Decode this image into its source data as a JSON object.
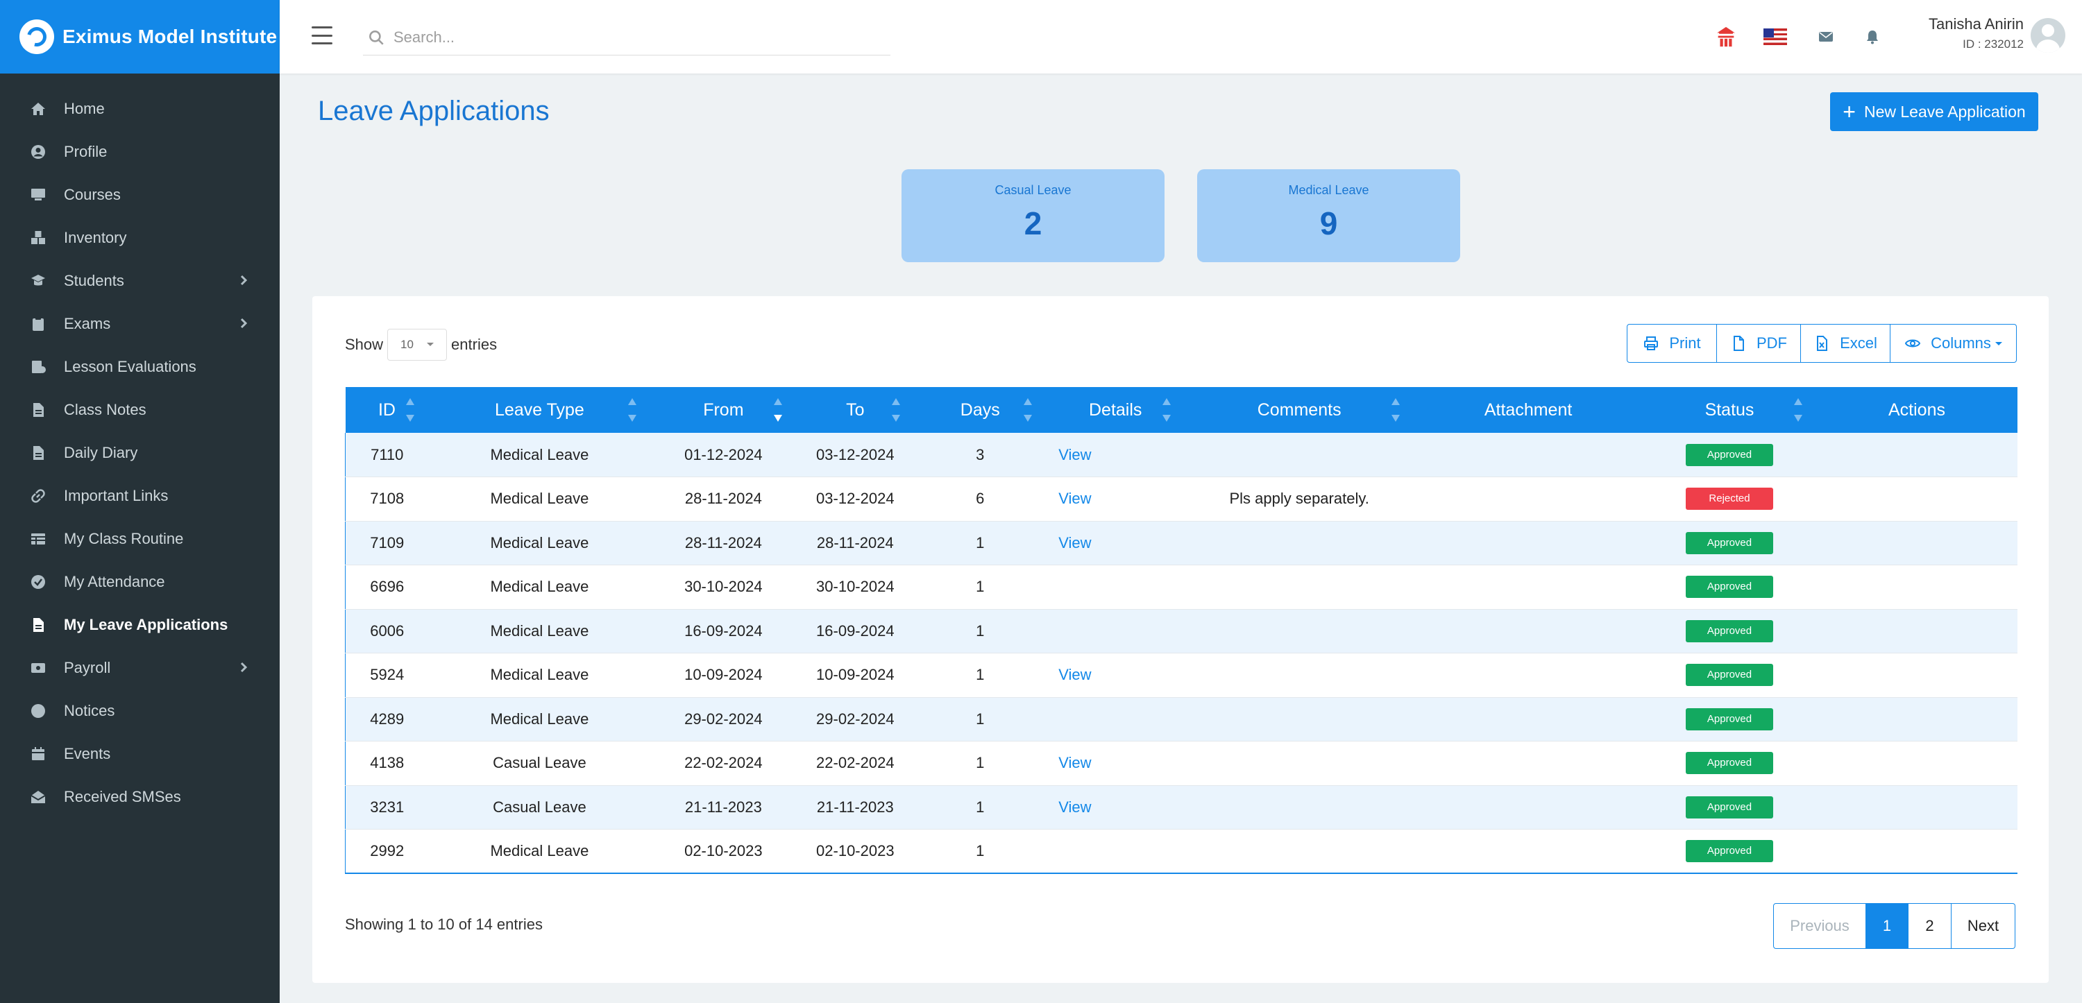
{
  "brand": {
    "name": "Eximus Model Institute"
  },
  "sidebar": {
    "items": [
      {
        "label": "Home",
        "icon": "home-icon"
      },
      {
        "label": "Profile",
        "icon": "user-circle-icon"
      },
      {
        "label": "Courses",
        "icon": "chalkboard-icon"
      },
      {
        "label": "Inventory",
        "icon": "boxes-icon"
      },
      {
        "label": "Students",
        "icon": "student-icon",
        "expandable": true
      },
      {
        "label": "Exams",
        "icon": "clipboard-icon",
        "expandable": true
      },
      {
        "label": "Lesson Evaluations",
        "icon": "evaluation-icon"
      },
      {
        "label": "Class Notes",
        "icon": "file-icon"
      },
      {
        "label": "Daily Diary",
        "icon": "file-icon"
      },
      {
        "label": "Important Links",
        "icon": "link-icon"
      },
      {
        "label": "My Class Routine",
        "icon": "table-icon"
      },
      {
        "label": "My Attendance",
        "icon": "check-circle-icon"
      },
      {
        "label": "My Leave Applications",
        "icon": "file-icon",
        "active": true
      },
      {
        "label": "Payroll",
        "icon": "money-icon",
        "expandable": true
      },
      {
        "label": "Notices",
        "icon": "circle-icon"
      },
      {
        "label": "Events",
        "icon": "calendar-icon"
      },
      {
        "label": "Received SMSes",
        "icon": "envelope-open-icon"
      }
    ]
  },
  "topbar": {
    "search_placeholder": "Search...",
    "user_name": "Tanisha Anirin",
    "user_id": "ID : 232012"
  },
  "page": {
    "title": "Leave Applications",
    "new_button": "New Leave Application"
  },
  "stats": [
    {
      "label": "Casual Leave",
      "value": "2"
    },
    {
      "label": "Medical Leave",
      "value": "9"
    }
  ],
  "table_controls": {
    "show_label": "Show",
    "entries_value": "10",
    "entries_label": "entries",
    "buttons": [
      "Print",
      "PDF",
      "Excel",
      "Columns"
    ]
  },
  "table": {
    "columns": [
      "ID",
      "Leave Type",
      "From",
      "To",
      "Days",
      "Details",
      "Comments",
      "Attachment",
      "Status",
      "Actions"
    ],
    "rows": [
      {
        "id": "7110",
        "type": "Medical Leave",
        "from": "01-12-2024",
        "to": "03-12-2024",
        "days": "3",
        "details": "View",
        "comments": "",
        "status": "Approved"
      },
      {
        "id": "7108",
        "type": "Medical Leave",
        "from": "28-11-2024",
        "to": "03-12-2024",
        "days": "6",
        "details": "View",
        "comments": "Pls apply separately.",
        "status": "Rejected"
      },
      {
        "id": "7109",
        "type": "Medical Leave",
        "from": "28-11-2024",
        "to": "28-11-2024",
        "days": "1",
        "details": "View",
        "comments": "",
        "status": "Approved"
      },
      {
        "id": "6696",
        "type": "Medical Leave",
        "from": "30-10-2024",
        "to": "30-10-2024",
        "days": "1",
        "details": "",
        "comments": "",
        "status": "Approved"
      },
      {
        "id": "6006",
        "type": "Medical Leave",
        "from": "16-09-2024",
        "to": "16-09-2024",
        "days": "1",
        "details": "",
        "comments": "",
        "status": "Approved"
      },
      {
        "id": "5924",
        "type": "Medical Leave",
        "from": "10-09-2024",
        "to": "10-09-2024",
        "days": "1",
        "details": "View",
        "comments": "",
        "status": "Approved"
      },
      {
        "id": "4289",
        "type": "Medical Leave",
        "from": "29-02-2024",
        "to": "29-02-2024",
        "days": "1",
        "details": "",
        "comments": "",
        "status": "Approved"
      },
      {
        "id": "4138",
        "type": "Casual Leave",
        "from": "22-02-2024",
        "to": "22-02-2024",
        "days": "1",
        "details": "View",
        "comments": "",
        "status": "Approved"
      },
      {
        "id": "3231",
        "type": "Casual Leave",
        "from": "21-11-2023",
        "to": "21-11-2023",
        "days": "1",
        "details": "View",
        "comments": "",
        "status": "Approved"
      },
      {
        "id": "2992",
        "type": "Medical Leave",
        "from": "02-10-2023",
        "to": "02-10-2023",
        "days": "1",
        "details": "",
        "comments": "",
        "status": "Approved"
      }
    ]
  },
  "footer": {
    "info": "Showing 1 to 10 of 14 entries",
    "pagination": [
      "Previous",
      "1",
      "2",
      "Next"
    ],
    "current_page": "1"
  },
  "colors": {
    "primary": "#1388e8",
    "sidebar_bg": "#263238",
    "approved": "#13a960",
    "rejected": "#ef3e4a",
    "stat_card": "#a3cef7"
  }
}
